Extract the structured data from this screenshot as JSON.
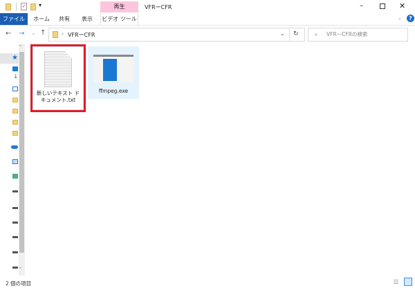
{
  "window": {
    "title": "VFRーCFR"
  },
  "ribbon": {
    "context_header": "再生",
    "tabs": [
      "ファイル",
      "ホーム",
      "共有",
      "表示",
      "ビデオ ツール"
    ]
  },
  "address": {
    "folder": "VFRーCFR"
  },
  "search": {
    "placeholder": "VFRーCFRの検索"
  },
  "files": [
    {
      "name": "新しいテキスト ドキュメント.txt",
      "icon": "text-document-icon"
    },
    {
      "name": "ffmpeg.exe",
      "icon": "exe-icon"
    }
  ],
  "status": {
    "count": "2 個の項目"
  },
  "colors": {
    "accent": "#1a5fb4",
    "highlight": "#e21b23",
    "selection": "#cce8ff",
    "context": "#fbc5de"
  }
}
